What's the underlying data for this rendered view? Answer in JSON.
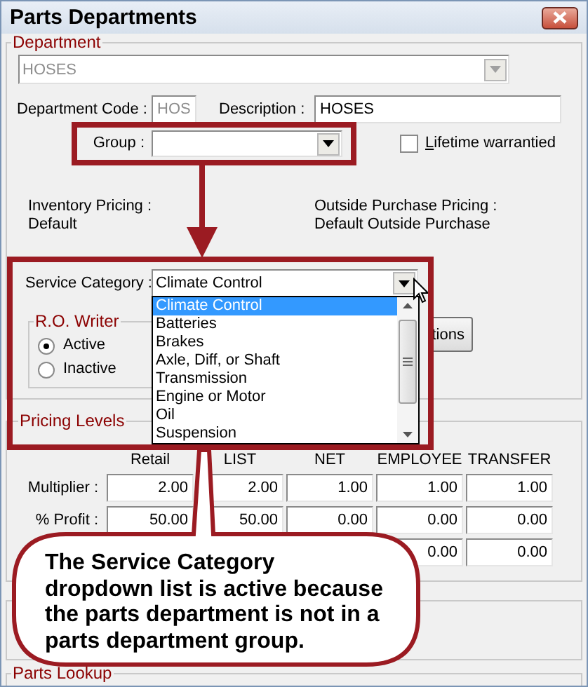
{
  "window": {
    "title": "Parts Departments"
  },
  "department": {
    "legend": "Department",
    "value": "HOSES",
    "code_label": "Department Code :",
    "code": "HOS",
    "description_label": "Description :",
    "description": "HOSES",
    "group_label": "Group :",
    "lifetime": {
      "label": "Lifetime warrantied",
      "checked": false
    },
    "inventory_label": "Inventory Pricing :",
    "inventory_value": "Default",
    "outside_label": "Outside Purchase Pricing :",
    "outside_value": "Default Outside Purchase",
    "service_category": {
      "label": "Service Category :",
      "value": "Climate Control",
      "expanded": true,
      "options": [
        {
          "label": "Climate Control",
          "selected": true
        },
        {
          "label": "Batteries",
          "selected": false
        },
        {
          "label": "Brakes",
          "selected": false
        },
        {
          "label": "Axle, Diff, or Shaft",
          "selected": false
        },
        {
          "label": "Transmission",
          "selected": false
        },
        {
          "label": "Engine or Motor",
          "selected": false
        },
        {
          "label": "Oil",
          "selected": false
        },
        {
          "label": "Suspension",
          "selected": false
        }
      ]
    },
    "ro_writer": {
      "legend": "R.O. Writer",
      "options": [
        {
          "label": "Active",
          "selected": true
        },
        {
          "label": "Inactive",
          "selected": false
        }
      ]
    },
    "options_button": "tions"
  },
  "pricing_levels": {
    "legend": "Pricing Levels",
    "columns": [
      "Retail",
      "LIST",
      "NET",
      "EMPLOYEE",
      "TRANSFER"
    ],
    "rows": [
      {
        "label": "Multiplier :",
        "cells": [
          "2.00",
          "2.00",
          "1.00",
          "1.00",
          "1.00"
        ]
      },
      {
        "label": "% Profit :",
        "cells": [
          "50.00",
          "50.00",
          "0.00",
          "0.00",
          "0.00"
        ]
      },
      {
        "cells": [
          "",
          "",
          "",
          "0.00",
          "0.00"
        ]
      }
    ]
  },
  "parts_lookup": {
    "legend": "Parts Lookup"
  },
  "callout": {
    "text": "The Service Category dropdown list is active because the parts department is not in a parts department group."
  }
}
